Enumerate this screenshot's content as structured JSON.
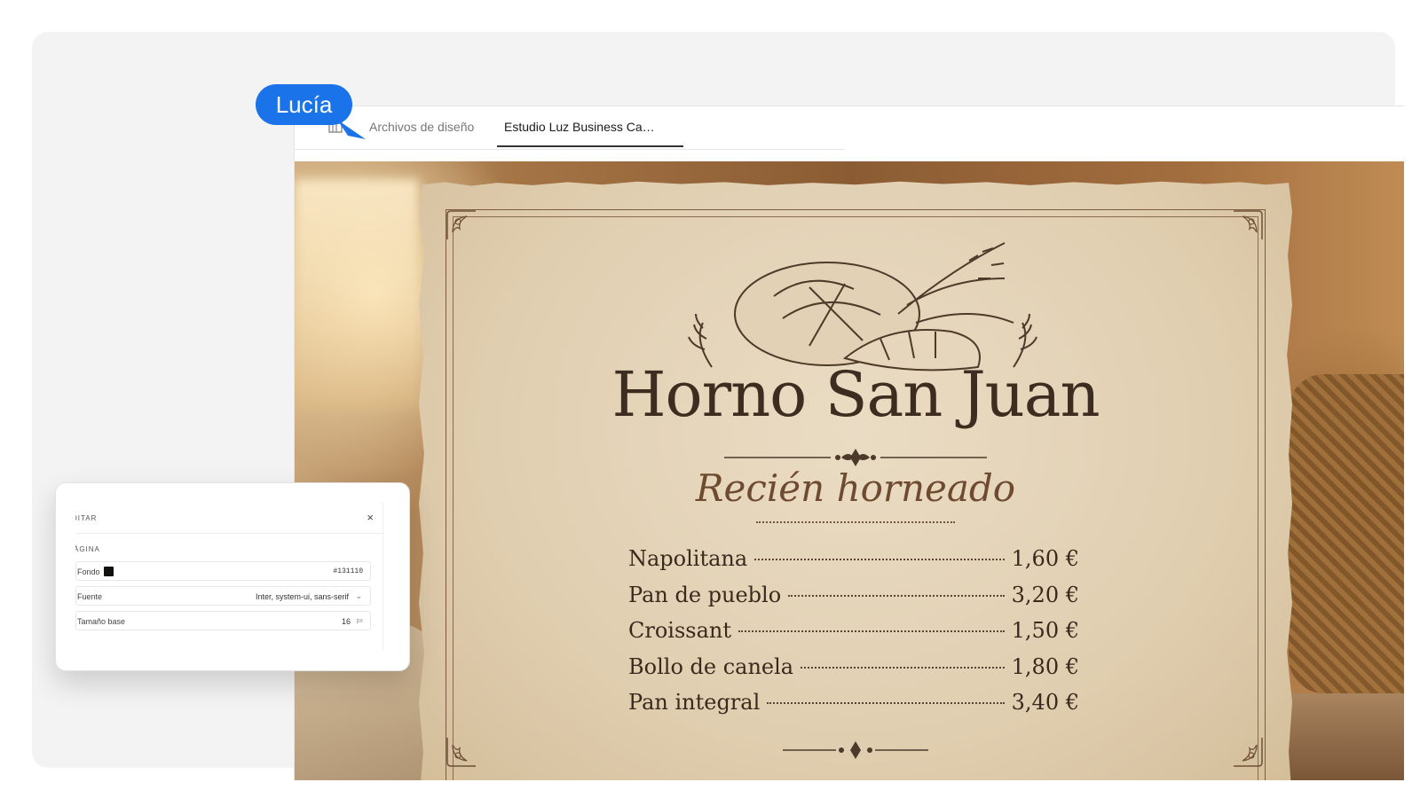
{
  "user": {
    "name": "Lucía"
  },
  "tabs": [
    {
      "label": "Archivos de diseño"
    },
    {
      "label": "Estudio Luz Business Ca…"
    }
  ],
  "menu": {
    "title": "Horno San Juan",
    "subtitle": "Recién horneado",
    "items": [
      {
        "name": "Napolitana",
        "price": "1,60 €"
      },
      {
        "name": "Pan de pueblo",
        "price": "3,20 €"
      },
      {
        "name": "Croissant",
        "price": "1,50 €"
      },
      {
        "name": "Bollo de canela",
        "price": "1,80 €"
      },
      {
        "name": "Pan integral",
        "price": "3,40 €"
      }
    ]
  },
  "panel": {
    "title": "DITAR",
    "close": "×",
    "section": "ÁGINA",
    "fields": {
      "background": {
        "label": "Fondo",
        "value": "#131110"
      },
      "font": {
        "label": "Fuente",
        "value": "Inter, system-ui, sans-serif"
      },
      "base_size": {
        "label": "Tamaño base",
        "value": "16",
        "unit": "px"
      }
    }
  },
  "colors": {
    "accent": "#1a73e8",
    "ink": "#3d2d20",
    "swatch": "#131110"
  }
}
